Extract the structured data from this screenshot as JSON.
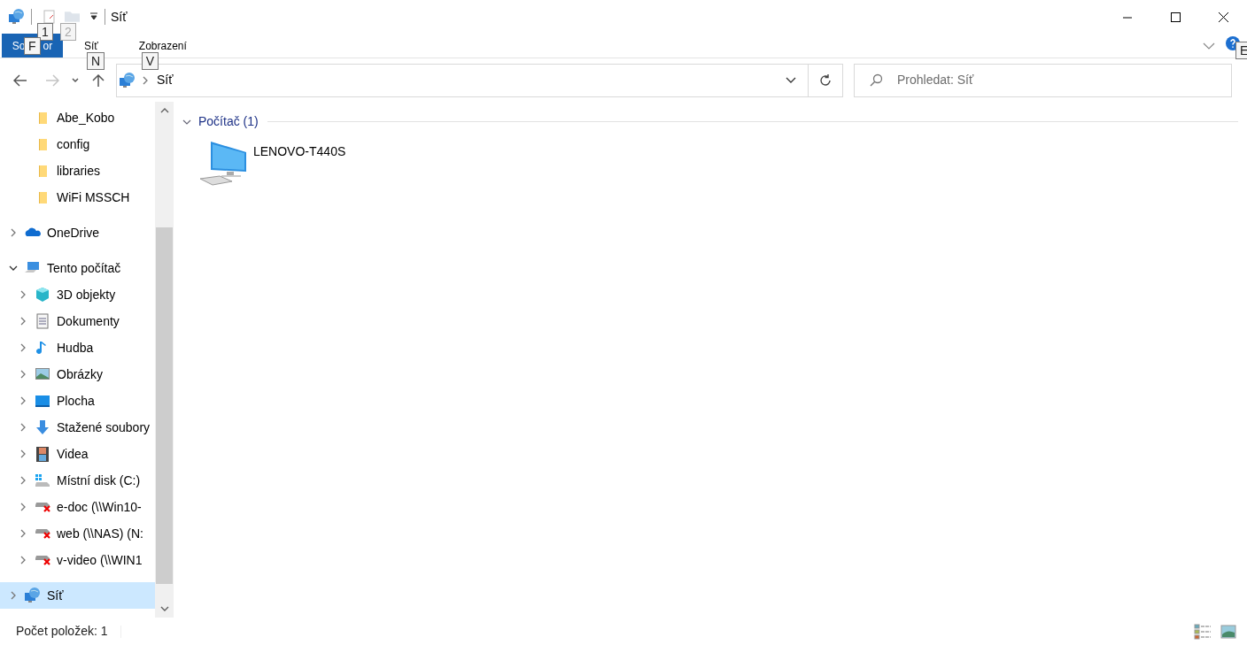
{
  "window": {
    "title": "Síť"
  },
  "quick_access": [
    {
      "kind": "properties",
      "keytip": "1",
      "disabled": false
    },
    {
      "kind": "new-folder",
      "keytip": "2",
      "disabled": true
    }
  ],
  "ribbon_tabs": [
    {
      "kind": "file",
      "label_parts": [
        "So",
        "or"
      ],
      "keytip": "F"
    },
    {
      "kind": "tab",
      "label": "Síť",
      "keytip": "N"
    },
    {
      "kind": "tab",
      "label": "Zobrazení",
      "keytip": "V"
    }
  ],
  "help": {
    "keytip": "E"
  },
  "navigation": {
    "back_disabled": false,
    "forward_disabled": true
  },
  "address_bar": {
    "path": [
      "Síť"
    ]
  },
  "search": {
    "placeholder": "Prohledat: Síť"
  },
  "nav_tree": [
    {
      "children": [
        {
          "label": "Abe_Kobo",
          "kind": "folder",
          "selected": false
        },
        {
          "label": "config",
          "kind": "folder",
          "selected": false
        },
        {
          "label": "libraries",
          "kind": "folder",
          "selected": false
        },
        {
          "label": "WiFi MSSCH",
          "kind": "folder",
          "selected": false
        }
      ]
    },
    {
      "label": "OneDrive",
      "kind": "onedrive",
      "expanded": false,
      "selected": false
    },
    {
      "label": "Tento počítač",
      "kind": "pc",
      "expanded": true,
      "selected": false,
      "children": [
        {
          "label": "3D objekty",
          "kind": "cube",
          "expanded": false,
          "selected": false
        },
        {
          "label": "Dokumenty",
          "kind": "documents",
          "expanded": false,
          "selected": false
        },
        {
          "label": "Hudba",
          "kind": "music",
          "expanded": false,
          "selected": false
        },
        {
          "label": "Obrázky",
          "kind": "pictures",
          "expanded": false,
          "selected": false
        },
        {
          "label": "Plocha",
          "kind": "desktop",
          "expanded": false,
          "selected": false
        },
        {
          "label": "Stažené soubory",
          "kind": "downloads",
          "expanded": false,
          "selected": false
        },
        {
          "label": "Videa",
          "kind": "videos",
          "expanded": false,
          "selected": false
        },
        {
          "label": "Místní disk (C:)",
          "kind": "localdisk",
          "expanded": false,
          "selected": false
        },
        {
          "label": "e-doc (\\\\Win10-",
          "kind": "netdrive",
          "expanded": false,
          "selected": false
        },
        {
          "label": "web (\\\\NAS) (N:",
          "kind": "netdrive",
          "expanded": false,
          "selected": false
        },
        {
          "label": "v-video (\\\\WIN1",
          "kind": "netdrive",
          "expanded": false,
          "selected": false
        }
      ]
    },
    {
      "label": "Síť",
      "kind": "network",
      "expanded": false,
      "selected": true
    }
  ],
  "content": {
    "groups": [
      {
        "label": "Počítač (1)",
        "expanded": true,
        "items": [
          {
            "name": "LENOVO-T440S",
            "kind": "computer"
          }
        ]
      }
    ]
  },
  "status_bar": {
    "item_count": "Počet položek: 1"
  },
  "view_modes": [
    {
      "kind": "details"
    },
    {
      "kind": "large-icons"
    }
  ]
}
